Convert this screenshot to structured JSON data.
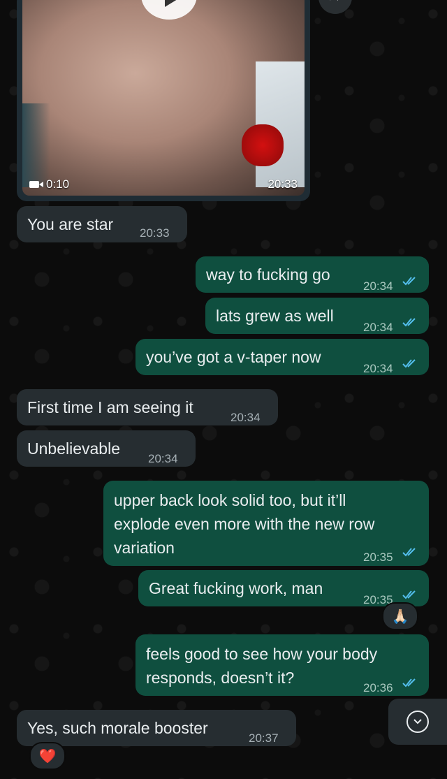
{
  "video_message": {
    "duration": "0:10",
    "time": "20:33"
  },
  "messages": [
    {
      "text": "You are star",
      "time": "20:33"
    },
    {
      "text": "way to fucking go",
      "time": "20:34"
    },
    {
      "text": "lats grew as well",
      "time": "20:34"
    },
    {
      "text": "you’ve got a v-taper now",
      "time": "20:34"
    },
    {
      "text": "First time I am seeing it",
      "time": "20:34"
    },
    {
      "text": "Unbelievable",
      "time": "20:34"
    },
    {
      "text": "upper back look solid too, but it’ll",
      "text2": "explode even more with the new row",
      "text3": "variation",
      "time": "20:35"
    },
    {
      "text": "Great fucking work, man",
      "time": "20:35",
      "reaction": "🙏🏻"
    },
    {
      "text": "feels good to see how your body",
      "text2": "responds, doesn’t it?",
      "time": "20:36"
    },
    {
      "text": "Yes, such morale booster",
      "time": "20:37",
      "reaction": "❤️"
    }
  ],
  "icons": {
    "forward": "forward-icon",
    "play": "play-icon",
    "scroll": "chevron-down-icon"
  },
  "colors": {
    "incoming_bubble": "#262d31",
    "outgoing_bubble": "#0f4f3f",
    "read_ticks": "#53bdeb"
  }
}
